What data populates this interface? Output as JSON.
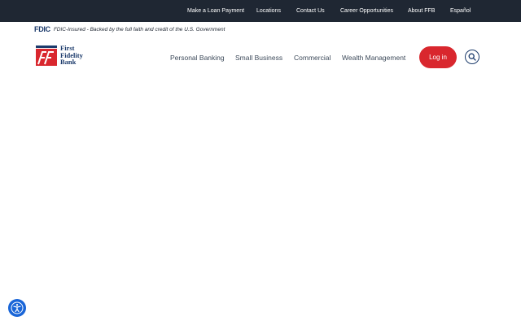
{
  "utility_nav": [
    {
      "label": "Make a Loan Payment"
    },
    {
      "label": "Locations"
    },
    {
      "label": "Contact Us"
    },
    {
      "label": "Career Opportunities"
    },
    {
      "label": "About FFB"
    },
    {
      "label": "Español"
    }
  ],
  "fdic": {
    "logo_text": "FDIC",
    "statement": "FDIC-Insured - Backed by the full faith and credit of the U.S. Government"
  },
  "brand": {
    "line1": "First",
    "line2": "Fidelity",
    "line3": "Bank"
  },
  "main_nav": [
    {
      "label": "Personal Banking"
    },
    {
      "label": "Small Business"
    },
    {
      "label": "Commercial"
    },
    {
      "label": "Wealth Management"
    }
  ],
  "login_label": "Log in",
  "icons": {
    "search": "search-icon",
    "accessibility": "accessibility-icon"
  },
  "colors": {
    "topbar": "#1f2733",
    "brand_navy": "#1b3a6b",
    "brand_red": "#d9272e",
    "accessibility_blue": "#1a66d8"
  }
}
